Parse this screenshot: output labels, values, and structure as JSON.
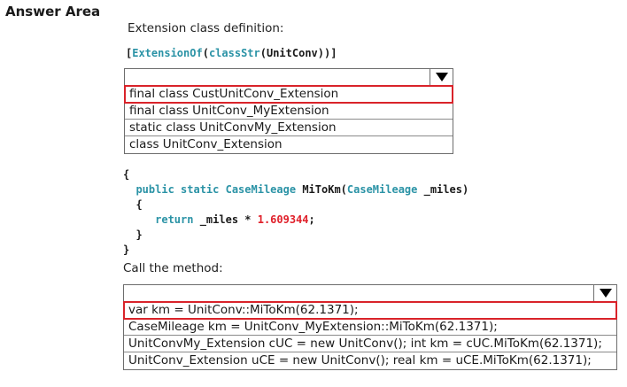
{
  "heading": "Answer Area",
  "ext_label": "Extension class definition:",
  "attr_code": {
    "open": "[",
    "kw_extension": "ExtensionOf",
    "paren1": "(",
    "kw_classstr": "classStr",
    "rest": "(UnitConv))]"
  },
  "dropdown1": {
    "options": [
      "final class CustUnitConv_Extension",
      "final class UnitConv_MyExtension",
      "static class UnitConvMy_Extension",
      "class  UnitConv_Extension"
    ],
    "selected_index": 0
  },
  "method_code": {
    "l1": "{",
    "l2_kw": "public static",
    "l2_type": "CaseMileage",
    "l2_name": " MiToKm(",
    "l2_type2": "CaseMileage",
    "l2_rest": " _miles)",
    "l3": "{",
    "l4_kw": "return",
    "l4_rest": " _miles * ",
    "l4_num": "1.609344",
    "l4_end": ";",
    "l5": "}",
    "l6": "}"
  },
  "call_label": "Call the method:",
  "dropdown2": {
    "options": [
      "var km = UnitConv::MiToKm(62.1371);",
      "CaseMileage km = UnitConv_MyExtension::MiToKm(62.1371);",
      "UnitConvMy_Extension cUC = new UnitConv(); int km = cUC.MiToKm(62.1371);",
      "UnitConv_Extension uCE = new UnitConv(); real km = uCE.MiToKm(62.1371);"
    ],
    "selected_index": 0
  },
  "colors": {
    "keyword": "#2b93a6",
    "number": "#e0212b",
    "selection": "#d9232a"
  }
}
